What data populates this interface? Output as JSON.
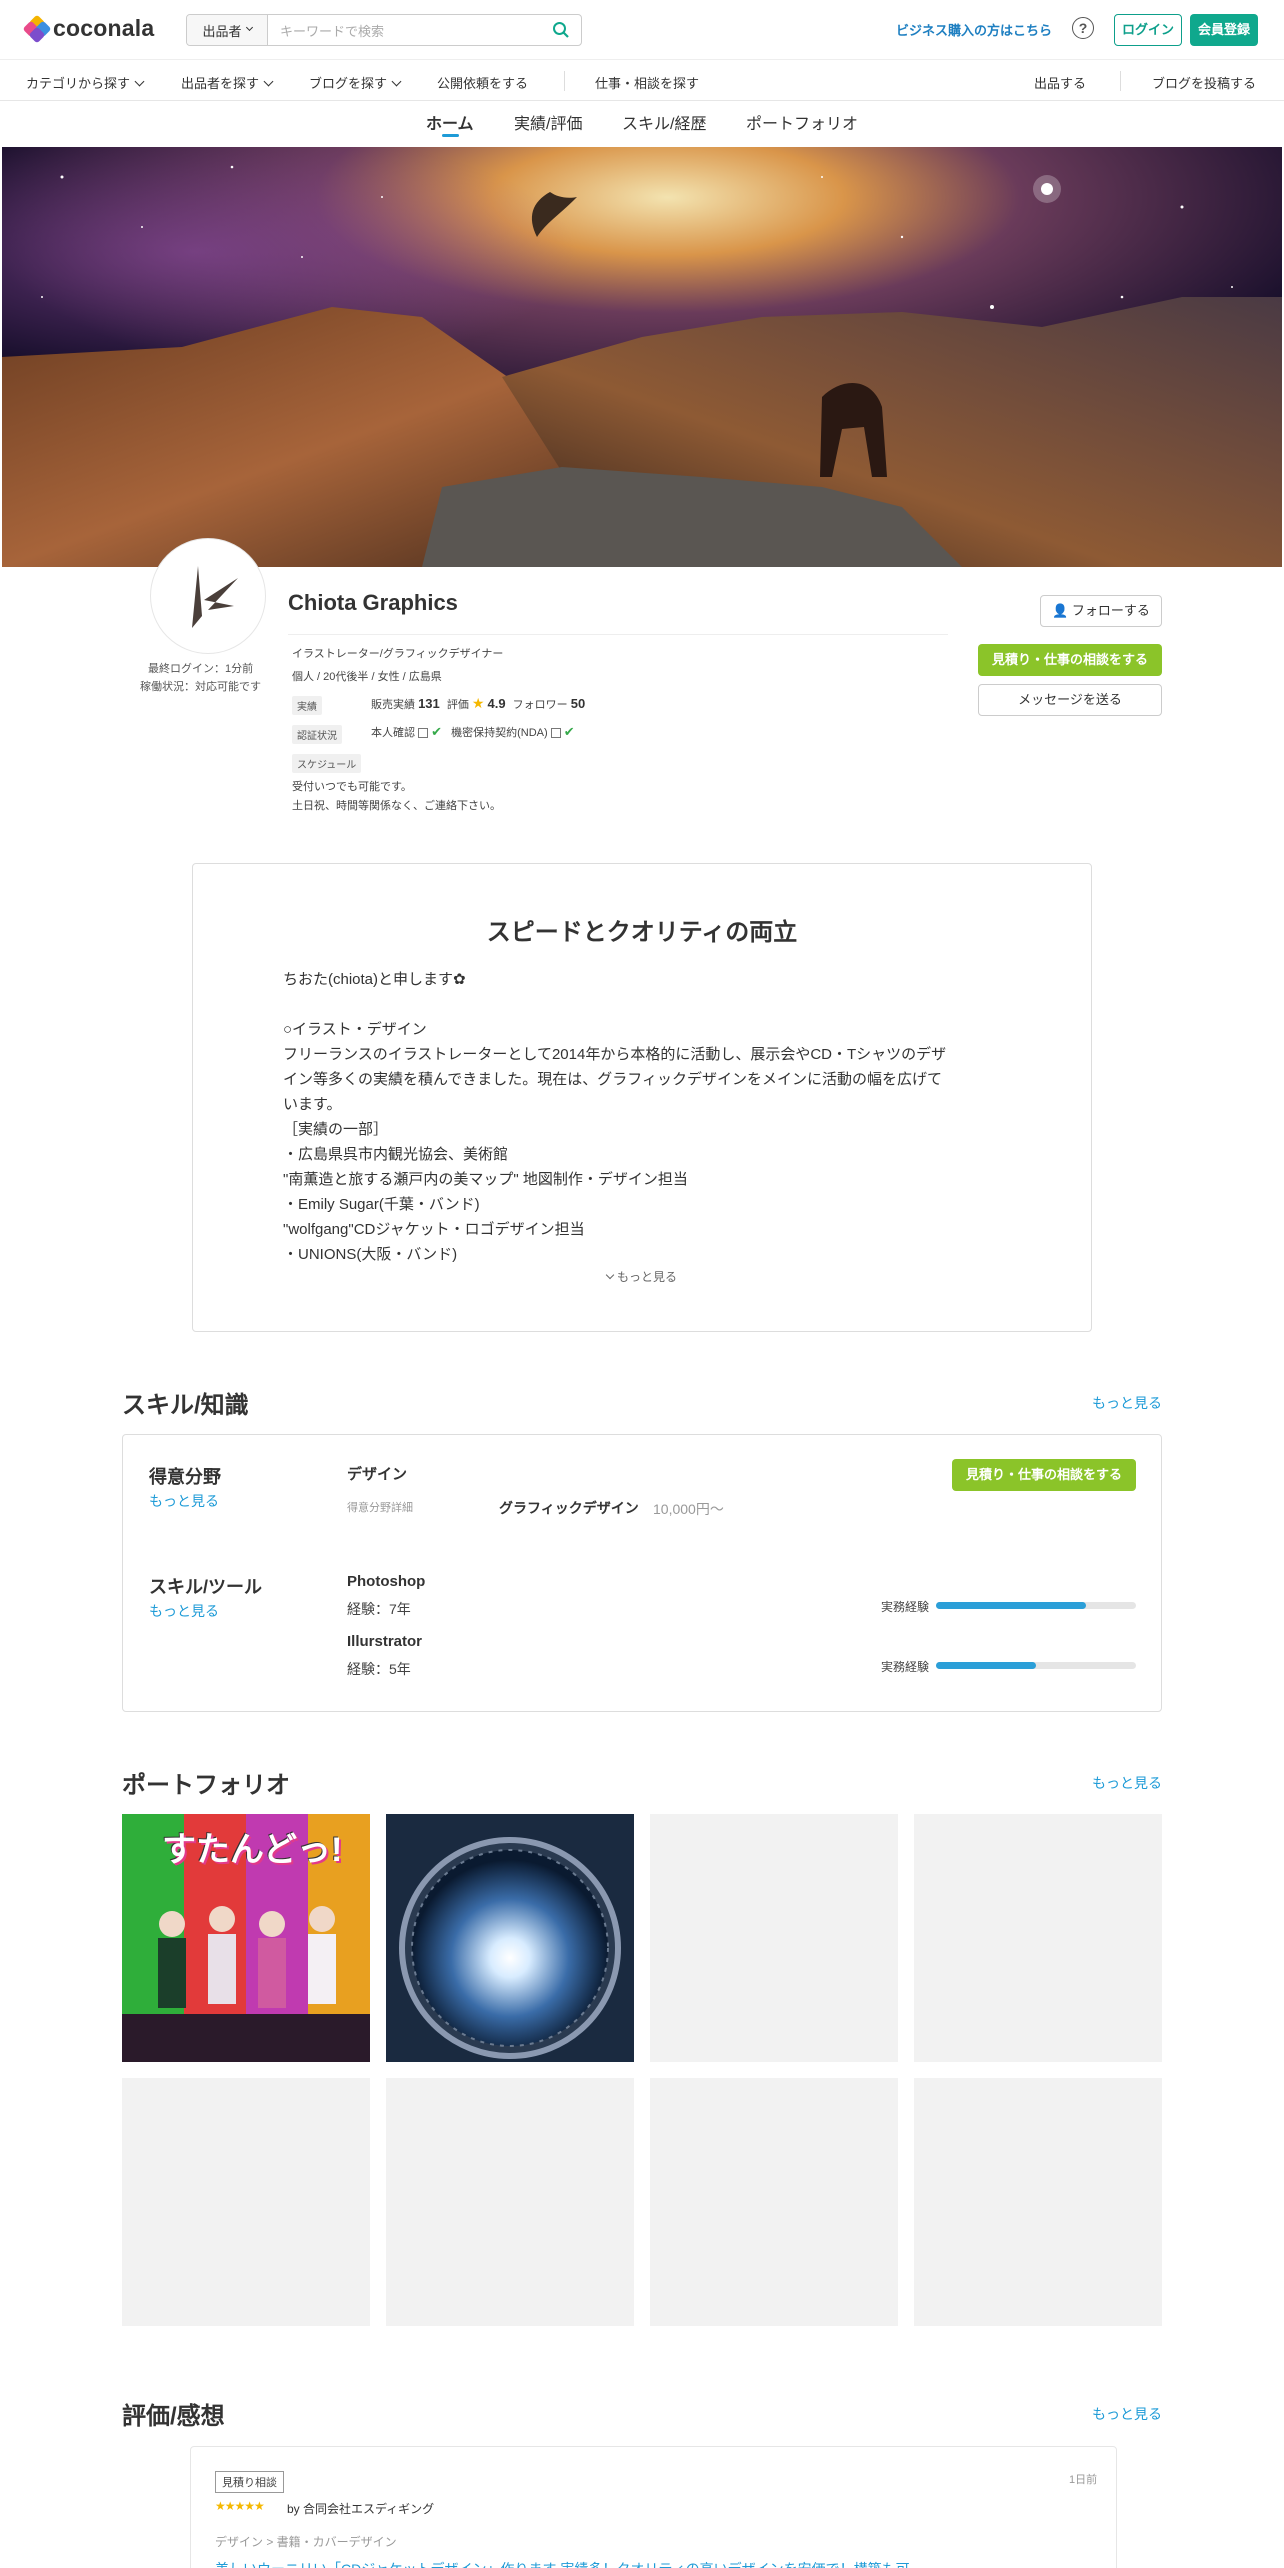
{
  "header": {
    "logo_text": "coconala",
    "search_select": "出品者",
    "search_placeholder": "キーワードで検索",
    "business_link": "ビジネス購入の方はこちら",
    "help": "?",
    "login": "ログイン",
    "register": "会員登録"
  },
  "nav": {
    "items": [
      "カテゴリから探す",
      "出品者を探す",
      "ブログを探す",
      "公開依頼をする",
      "仕事・相談を探す",
      "出品する",
      "ブログを投稿する"
    ]
  },
  "tabs": [
    "ホーム",
    "実績/評価",
    "スキル/経歴",
    "ポートフォリオ"
  ],
  "profile": {
    "name": "Chiota Graphics",
    "last_login": "最終ログイン：1分前",
    "work_status": "稼働状況：対応可能です",
    "occupation": "イラストレーター/グラフィックデザイナー",
    "attributes": "個人 / 20代後半 / 女性 / 広島県",
    "tag_record": "実績",
    "sales_label": "販売実績",
    "sales_value": "131",
    "rating_label": "評価",
    "rating_value": "4.9",
    "follower_label": "フォロワー",
    "follower_value": "50",
    "tag_auth": "認証状況",
    "identity": "本人確認",
    "nda": "機密保持契約(NDA)",
    "tag_schedule": "スケジュール",
    "schedule_1": "受付いつでも可能です。",
    "schedule_2": "土日祝、時間等関係なく、ご連絡下さい。",
    "follow_button": "フォローする",
    "estimate_button": "見積り・仕事の相談をする",
    "message_button": "メッセージを送る"
  },
  "intro": {
    "title": "スピードとクオリティの両立",
    "lines": [
      "ちおた(chiota)と申します✿",
      "",
      "○イラスト・デザイン",
      "フリーランスのイラストレーターとして2014年から本格的に活動し、展示会やCD・Tシャツのデザ",
      "イン等多くの実績を積んできました。現在は、グラフィックデザインをメインに活動の幅を広げて",
      "います。",
      "［実績の一部］",
      "・広島県呉市内観光協会、美術館",
      "\"南薫造と旅する瀬戸内の美マップ\" 地図制作・デザイン担当",
      "・Emily Sugar(千葉・バンド)",
      "\"wolfgang\"CDジャケット・ロゴデザイン担当",
      "・UNIONS(大阪・バンド)"
    ],
    "more": "もっと見る"
  },
  "skills": {
    "title": "スキル/知識",
    "more": "もっと見る",
    "specialty_title": "得意分野",
    "specialty_more": "もっと見る",
    "design_label": "デザイン",
    "detail_label": "得意分野詳細",
    "graphic": "グラフィックデザイン",
    "price": "10,000円〜",
    "estimate_button": "見積り・仕事の相談をする",
    "tools_title": "スキル/ツール",
    "tools_more": "もっと見る",
    "tools": [
      {
        "name": "Photoshop",
        "exp": "経験：7年",
        "label": "実務経験",
        "level": 0.75
      },
      {
        "name": "Illurstrator",
        "exp": "経験：5年",
        "label": "実務経験",
        "level": 0.5
      }
    ]
  },
  "portfolio": {
    "title": "ポートフォリオ",
    "more": "もっと見る",
    "thumb1_text": "すたんどっ!"
  },
  "reviews": {
    "title": "評価/感想",
    "more": "もっと見る",
    "badge": "見積り相談",
    "date": "1日前",
    "stars": "★★★★★",
    "by": "by 合同会社エスディギング",
    "category": "デザイン > 書籍・カバーデザイン",
    "service_title": "美しいウーニリい「CDジャケットデザイン」作ります 実績多！クオリティの高いデザインを安価で！構築も可"
  },
  "colors": {
    "accent_blue": "#1e9bd7",
    "green": "#8bc429",
    "teal": "#0fa88d"
  }
}
